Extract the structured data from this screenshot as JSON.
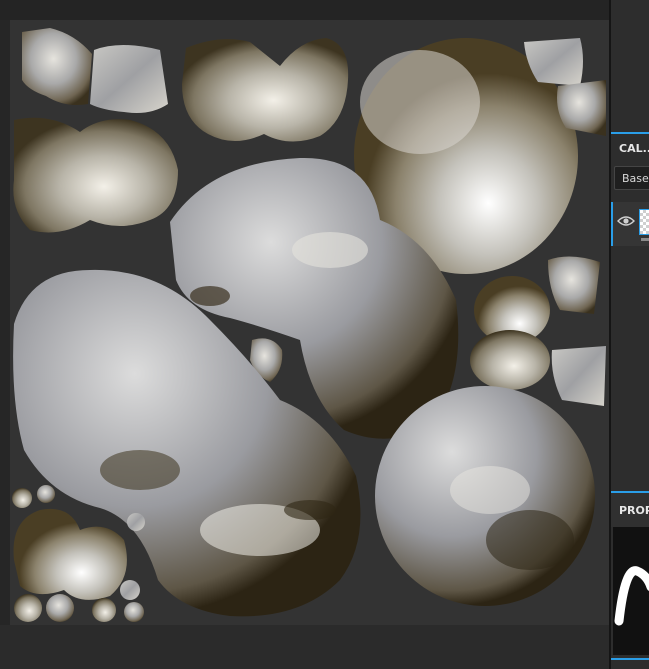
{
  "layers_panel": {
    "title": "CAL...",
    "blend_mode": "Base"
  },
  "properties_panel": {
    "title": "PROP"
  },
  "colors": {
    "accent": "#2a9ee8",
    "uv_background": "#333333",
    "app_background": "#262626"
  },
  "icons": {
    "visibility": "eye-icon"
  }
}
